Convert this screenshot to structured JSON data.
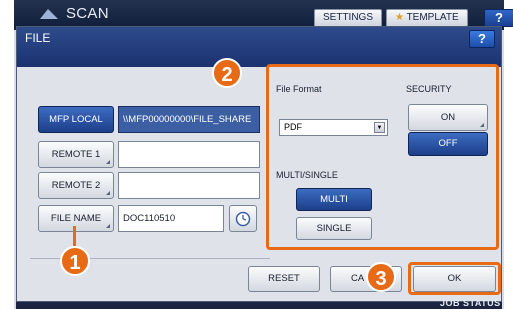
{
  "app": {
    "title": "SCAN",
    "settings_label": "SETTINGS",
    "template_label": "TEMPLATE",
    "help_label": "?"
  },
  "dialog": {
    "title": "FILE",
    "help_label": "?"
  },
  "left": {
    "mfp_local_label": "MFP LOCAL",
    "mfp_local_path": "\\\\MFP00000000\\FILE_SHARE",
    "remote1_label": "REMOTE 1",
    "remote1_value": "",
    "remote2_label": "REMOTE 2",
    "remote2_value": "",
    "file_name_label": "FILE NAME",
    "file_name_value": "DOC110510"
  },
  "settings_panel": {
    "file_format_label": "File Format",
    "file_format_value": "PDF",
    "multi_single_label": "MULTI/SINGLE",
    "multi_label": "MULTI",
    "single_label": "SINGLE",
    "security_label": "SECURITY",
    "on_label": "ON",
    "off_label": "OFF"
  },
  "footer": {
    "reset_label": "RESET",
    "cancel_label": "CA",
    "ok_label": "OK",
    "status_fragment": "JOB STATUS"
  },
  "callouts": {
    "one": "1",
    "two": "2",
    "three": "3"
  },
  "colors": {
    "accent_orange": "#e76a17",
    "selected_blue": "#1c3f8a",
    "header_navy": "#1b3270"
  }
}
